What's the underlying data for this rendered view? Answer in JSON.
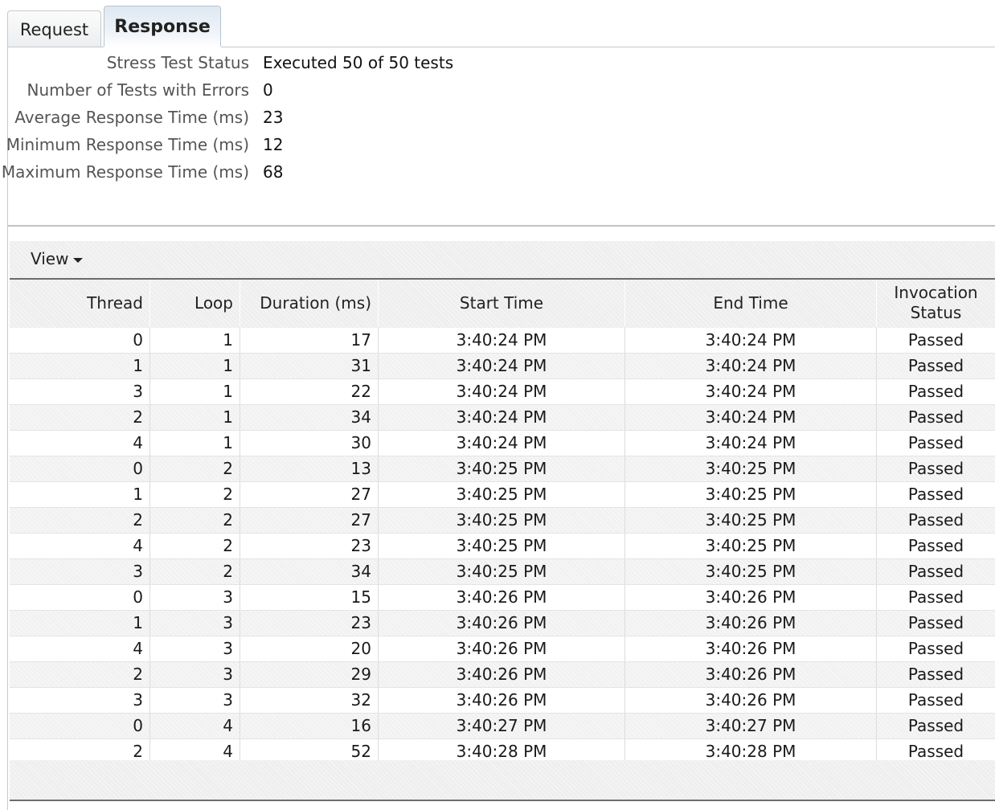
{
  "tabs": [
    {
      "label": "Request",
      "active": false
    },
    {
      "label": "Response",
      "active": true
    }
  ],
  "summary": [
    {
      "label": "Stress Test Status",
      "value": "Executed 50 of 50 tests"
    },
    {
      "label": "Number of Tests with Errors",
      "value": "0"
    },
    {
      "label": "Average Response Time (ms)",
      "value": "23"
    },
    {
      "label": "Minimum Response Time (ms)",
      "value": "12"
    },
    {
      "label": "Maximum Response Time (ms)",
      "value": "68"
    }
  ],
  "toolbar": {
    "view_label": "View"
  },
  "table": {
    "columns": [
      "Thread",
      "Loop",
      "Duration (ms)",
      "Start Time",
      "End Time",
      "Invocation",
      "Status"
    ],
    "rows": [
      [
        "0",
        "1",
        "17",
        "3:40:24 PM",
        "3:40:24 PM",
        "Passed"
      ],
      [
        "1",
        "1",
        "31",
        "3:40:24 PM",
        "3:40:24 PM",
        "Passed"
      ],
      [
        "3",
        "1",
        "22",
        "3:40:24 PM",
        "3:40:24 PM",
        "Passed"
      ],
      [
        "2",
        "1",
        "34",
        "3:40:24 PM",
        "3:40:24 PM",
        "Passed"
      ],
      [
        "4",
        "1",
        "30",
        "3:40:24 PM",
        "3:40:24 PM",
        "Passed"
      ],
      [
        "0",
        "2",
        "13",
        "3:40:25 PM",
        "3:40:25 PM",
        "Passed"
      ],
      [
        "1",
        "2",
        "27",
        "3:40:25 PM",
        "3:40:25 PM",
        "Passed"
      ],
      [
        "2",
        "2",
        "27",
        "3:40:25 PM",
        "3:40:25 PM",
        "Passed"
      ],
      [
        "4",
        "2",
        "23",
        "3:40:25 PM",
        "3:40:25 PM",
        "Passed"
      ],
      [
        "3",
        "2",
        "34",
        "3:40:25 PM",
        "3:40:25 PM",
        "Passed"
      ],
      [
        "0",
        "3",
        "15",
        "3:40:26 PM",
        "3:40:26 PM",
        "Passed"
      ],
      [
        "1",
        "3",
        "23",
        "3:40:26 PM",
        "3:40:26 PM",
        "Passed"
      ],
      [
        "4",
        "3",
        "20",
        "3:40:26 PM",
        "3:40:26 PM",
        "Passed"
      ],
      [
        "2",
        "3",
        "29",
        "3:40:26 PM",
        "3:40:26 PM",
        "Passed"
      ],
      [
        "3",
        "3",
        "32",
        "3:40:26 PM",
        "3:40:26 PM",
        "Passed"
      ],
      [
        "0",
        "4",
        "16",
        "3:40:27 PM",
        "3:40:27 PM",
        "Passed"
      ],
      [
        "2",
        "4",
        "52",
        "3:40:28 PM",
        "3:40:28 PM",
        "Passed"
      ]
    ]
  }
}
